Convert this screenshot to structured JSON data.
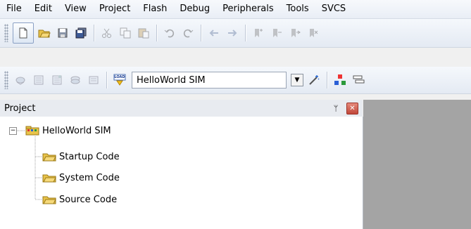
{
  "menu": [
    "File",
    "Edit",
    "View",
    "Project",
    "Flash",
    "Debug",
    "Peripherals",
    "Tools",
    "SVCS"
  ],
  "toolbar1": {
    "icons": [
      "new-file-icon",
      "open-folder-icon",
      "save-icon",
      "save-all-icon",
      "cut-icon",
      "copy-icon",
      "paste-icon",
      "undo-icon",
      "redo-icon",
      "back-icon",
      "forward-icon",
      "bookmark-icon",
      "bookmark-prev-icon",
      "bookmark-next-icon",
      "bookmark-clear-icon"
    ]
  },
  "toolbar2": {
    "load_label": "LOAD",
    "target": "HelloWorld SIM"
  },
  "project_pane": {
    "title": "Project",
    "pin": "ᛘ",
    "close": "✕",
    "root": "HelloWorld SIM",
    "groups": [
      "Startup Code",
      "System Code",
      "Source Code"
    ]
  },
  "colors": {
    "folder": "#e8c34a",
    "workspace": "#a4a4a4"
  }
}
